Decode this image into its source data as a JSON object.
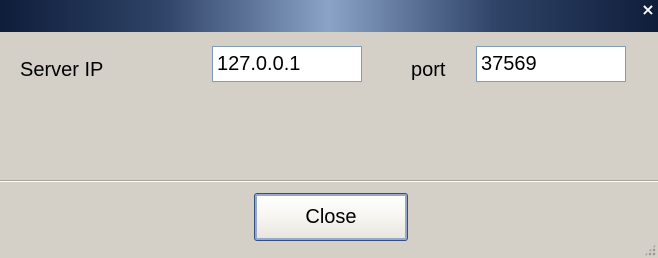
{
  "window": {
    "close_glyph": "×"
  },
  "form": {
    "server_ip_label": "Server IP",
    "server_ip_value": "127.0.0.1",
    "port_label": "port",
    "port_value": "37569"
  },
  "actions": {
    "close_label": "Close"
  }
}
